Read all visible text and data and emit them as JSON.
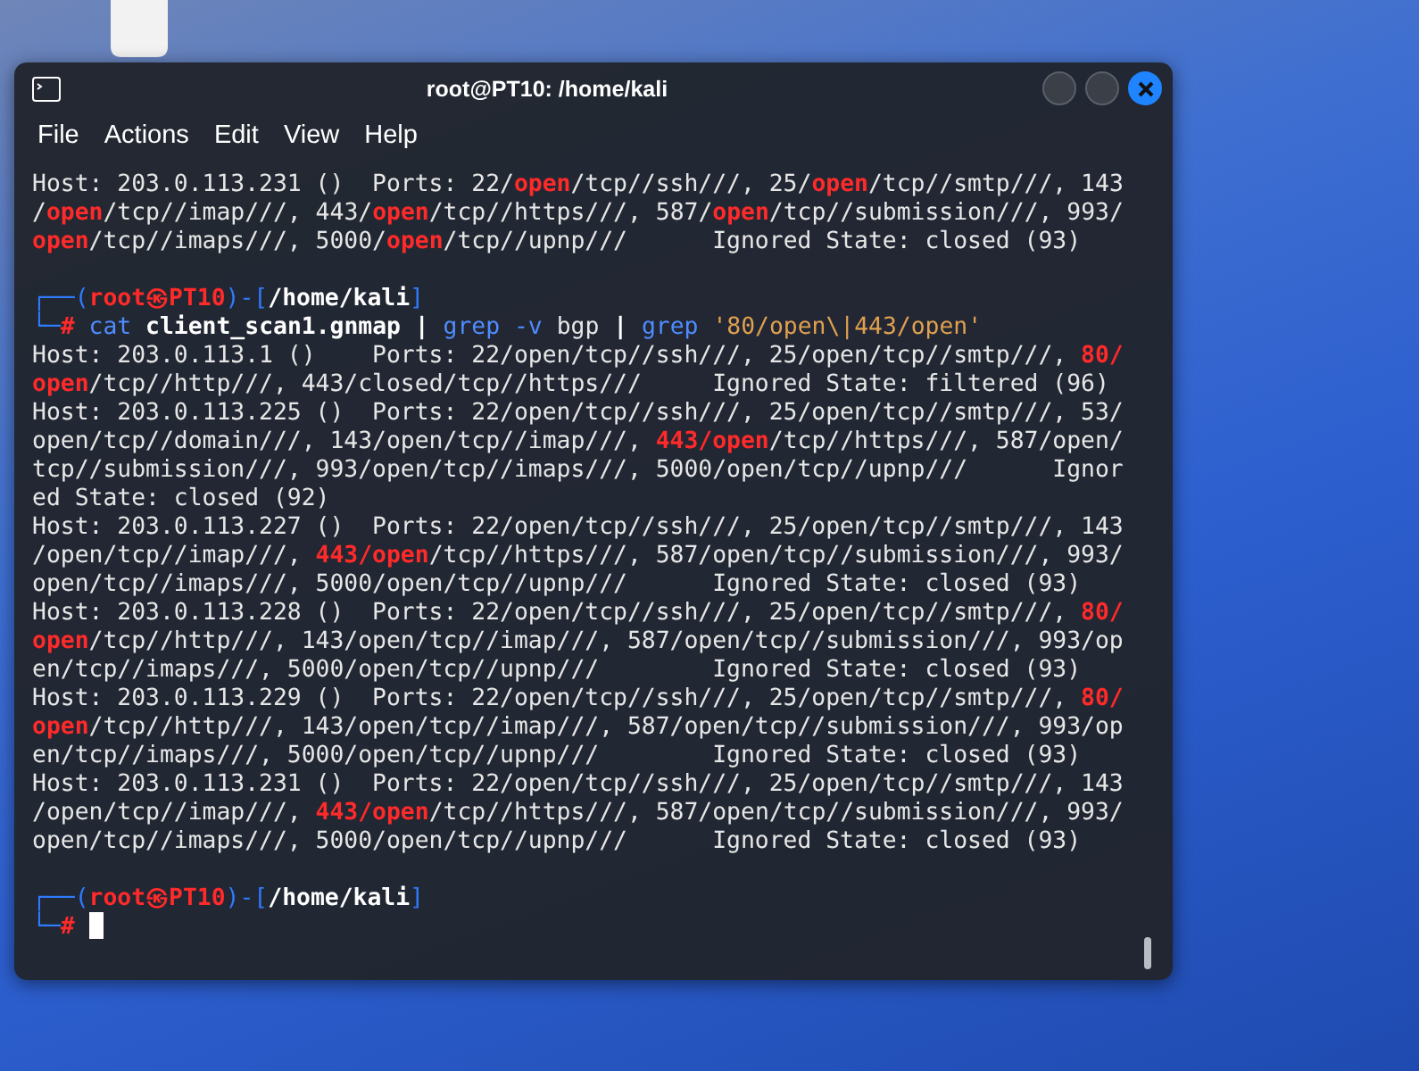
{
  "window": {
    "title": "root@PT10: /home/kali"
  },
  "menu": [
    "File",
    "Actions",
    "Edit",
    "View",
    "Help"
  ],
  "terminal": {
    "blocks": [
      {
        "lines": [
          {
            "segments": [
              {
                "text": "Host: 203.0.113.231 ()  Ports: 22/",
                "kind": "plain"
              },
              {
                "text": "open",
                "kind": "match"
              },
              {
                "text": "/tcp//ssh///, 25/",
                "kind": "plain"
              },
              {
                "text": "open",
                "kind": "match"
              },
              {
                "text": "/tcp//smtp///, 143",
                "kind": "plain"
              }
            ]
          },
          {
            "segments": [
              {
                "text": "/",
                "kind": "plain"
              },
              {
                "text": "open",
                "kind": "match"
              },
              {
                "text": "/tcp//imap///, 443/",
                "kind": "plain"
              },
              {
                "text": "open",
                "kind": "match"
              },
              {
                "text": "/tcp//https///, 587/",
                "kind": "plain"
              },
              {
                "text": "open",
                "kind": "match"
              },
              {
                "text": "/tcp//submission///, 993/",
                "kind": "plain"
              }
            ]
          },
          {
            "segments": [
              {
                "text": "open",
                "kind": "match"
              },
              {
                "text": "/tcp//imaps///, 5000/",
                "kind": "plain"
              },
              {
                "text": "open",
                "kind": "match"
              },
              {
                "text": "/tcp//upnp///      Ignored State: closed (93)",
                "kind": "plain"
              }
            ]
          }
        ]
      },
      {
        "lines": [
          {
            "segments": [
              {
                "text": "┌──(",
                "kind": "frame"
              },
              {
                "text": "root㉿PT10",
                "kind": "user"
              },
              {
                "text": ")-[",
                "kind": "frame"
              },
              {
                "text": "/home/kali",
                "kind": "path"
              },
              {
                "text": "]",
                "kind": "frame"
              }
            ]
          },
          {
            "segments": [
              {
                "text": "└─",
                "kind": "frame"
              },
              {
                "text": "#",
                "kind": "user"
              },
              {
                "text": " cat ",
                "kind": "cmd"
              },
              {
                "text": "client_scan1.gnmap",
                "kind": "arg"
              },
              {
                "text": " | ",
                "kind": "pipe"
              },
              {
                "text": "grep -v ",
                "kind": "cmd"
              },
              {
                "text": "bgp",
                "kind": "plain"
              },
              {
                "text": " | ",
                "kind": "pipe"
              },
              {
                "text": "grep ",
                "kind": "cmd"
              },
              {
                "text": "'80/open\\|443/open'",
                "kind": "quote"
              }
            ]
          },
          {
            "segments": [
              {
                "text": "Host: 203.0.113.1 ()    Ports: 22/open/tcp//ssh///, 25/open/tcp//smtp///, ",
                "kind": "plain"
              },
              {
                "text": "80/",
                "kind": "match"
              }
            ]
          },
          {
            "segments": [
              {
                "text": "open",
                "kind": "match"
              },
              {
                "text": "/tcp//http///, 443/closed/tcp//https///     Ignored State: filtered (96)",
                "kind": "plain"
              }
            ]
          },
          {
            "segments": [
              {
                "text": "Host: 203.0.113.225 ()  Ports: 22/open/tcp//ssh///, 25/open/tcp//smtp///, 53/",
                "kind": "plain"
              }
            ]
          },
          {
            "segments": [
              {
                "text": "open/tcp//domain///, 143/open/tcp//imap///, ",
                "kind": "plain"
              },
              {
                "text": "443/open",
                "kind": "match"
              },
              {
                "text": "/tcp//https///, 587/open/",
                "kind": "plain"
              }
            ]
          },
          {
            "segments": [
              {
                "text": "tcp//submission///, 993/open/tcp//imaps///, 5000/open/tcp//upnp///      Ignor",
                "kind": "plain"
              }
            ]
          },
          {
            "segments": [
              {
                "text": "ed State: closed (92)",
                "kind": "plain"
              }
            ]
          },
          {
            "segments": [
              {
                "text": "Host: 203.0.113.227 ()  Ports: 22/open/tcp//ssh///, 25/open/tcp//smtp///, 143",
                "kind": "plain"
              }
            ]
          },
          {
            "segments": [
              {
                "text": "/open/tcp//imap///, ",
                "kind": "plain"
              },
              {
                "text": "443/open",
                "kind": "match"
              },
              {
                "text": "/tcp//https///, 587/open/tcp//submission///, 993/",
                "kind": "plain"
              }
            ]
          },
          {
            "segments": [
              {
                "text": "open/tcp//imaps///, 5000/open/tcp//upnp///      Ignored State: closed (93)",
                "kind": "plain"
              }
            ]
          },
          {
            "segments": [
              {
                "text": "Host: 203.0.113.228 ()  Ports: 22/open/tcp//ssh///, 25/open/tcp//smtp///, ",
                "kind": "plain"
              },
              {
                "text": "80/",
                "kind": "match"
              }
            ]
          },
          {
            "segments": [
              {
                "text": "open",
                "kind": "match"
              },
              {
                "text": "/tcp//http///, 143/open/tcp//imap///, 587/open/tcp//submission///, 993/op",
                "kind": "plain"
              }
            ]
          },
          {
            "segments": [
              {
                "text": "en/tcp//imaps///, 5000/open/tcp//upnp///        Ignored State: closed (93)",
                "kind": "plain"
              }
            ]
          },
          {
            "segments": [
              {
                "text": "Host: 203.0.113.229 ()  Ports: 22/open/tcp//ssh///, 25/open/tcp//smtp///, ",
                "kind": "plain"
              },
              {
                "text": "80/",
                "kind": "match"
              }
            ]
          },
          {
            "segments": [
              {
                "text": "open",
                "kind": "match"
              },
              {
                "text": "/tcp//http///, 143/open/tcp//imap///, 587/open/tcp//submission///, 993/op",
                "kind": "plain"
              }
            ]
          },
          {
            "segments": [
              {
                "text": "en/tcp//imaps///, 5000/open/tcp//upnp///        Ignored State: closed (93)",
                "kind": "plain"
              }
            ]
          },
          {
            "segments": [
              {
                "text": "Host: 203.0.113.231 ()  Ports: 22/open/tcp//ssh///, 25/open/tcp//smtp///, 143",
                "kind": "plain"
              }
            ]
          },
          {
            "segments": [
              {
                "text": "/open/tcp//imap///, ",
                "kind": "plain"
              },
              {
                "text": "443/open",
                "kind": "match"
              },
              {
                "text": "/tcp//https///, 587/open/tcp//submission///, 993/",
                "kind": "plain"
              }
            ]
          },
          {
            "segments": [
              {
                "text": "open/tcp//imaps///, 5000/open/tcp//upnp///      Ignored State: closed (93)",
                "kind": "plain"
              }
            ]
          }
        ]
      },
      {
        "lines": [
          {
            "segments": [
              {
                "text": "┌──(",
                "kind": "frame"
              },
              {
                "text": "root㉿PT10",
                "kind": "user"
              },
              {
                "text": ")-[",
                "kind": "frame"
              },
              {
                "text": "/home/kali",
                "kind": "path"
              },
              {
                "text": "]",
                "kind": "frame"
              }
            ]
          },
          {
            "segments": [
              {
                "text": "└─",
                "kind": "frame"
              },
              {
                "text": "#",
                "kind": "user"
              }
            ],
            "cursor": true
          }
        ]
      }
    ]
  }
}
